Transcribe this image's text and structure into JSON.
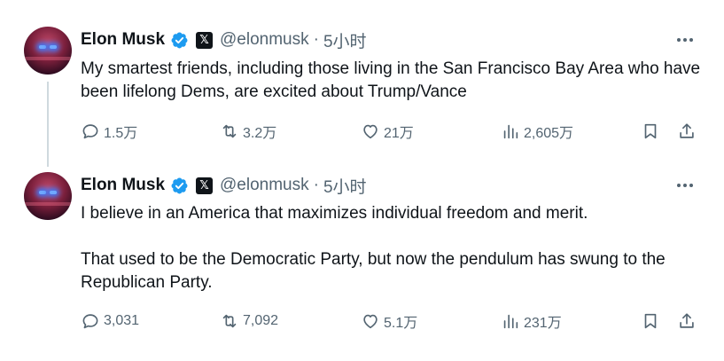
{
  "tweets": [
    {
      "author": {
        "name": "Elon Musk",
        "handle": "@elonmusk",
        "time": "5小时",
        "badge_text": "𝕏"
      },
      "paragraphs": [
        "My smartest friends, including those living in the San Francisco Bay Area who have been lifelong Dems, are excited about Trump/Vance"
      ],
      "stats": {
        "replies": "1.5万",
        "retweets": "3.2万",
        "likes": "21万",
        "views": "2,605万"
      }
    },
    {
      "author": {
        "name": "Elon Musk",
        "handle": "@elonmusk",
        "time": "5小时",
        "badge_text": "𝕏"
      },
      "paragraphs": [
        "I believe in an America that maximizes individual freedom and merit.",
        "That used to be the Democratic Party, but now the pendulum has swung to the Republican Party."
      ],
      "stats": {
        "replies": "3,031",
        "retweets": "7,092",
        "likes": "5.1万",
        "views": "231万"
      }
    }
  ],
  "icons": {
    "verified": "verified-badge-icon",
    "more": "more-horizontal-icon",
    "reply": "reply-icon",
    "retweet": "retweet-icon",
    "like": "heart-icon",
    "views": "views-chart-icon",
    "bookmark": "bookmark-icon",
    "share": "share-icon"
  },
  "colors": {
    "text_primary": "#0f1419",
    "text_secondary": "#536471",
    "verified_blue": "#1d9bf0",
    "thread_line": "#cfd9de"
  }
}
